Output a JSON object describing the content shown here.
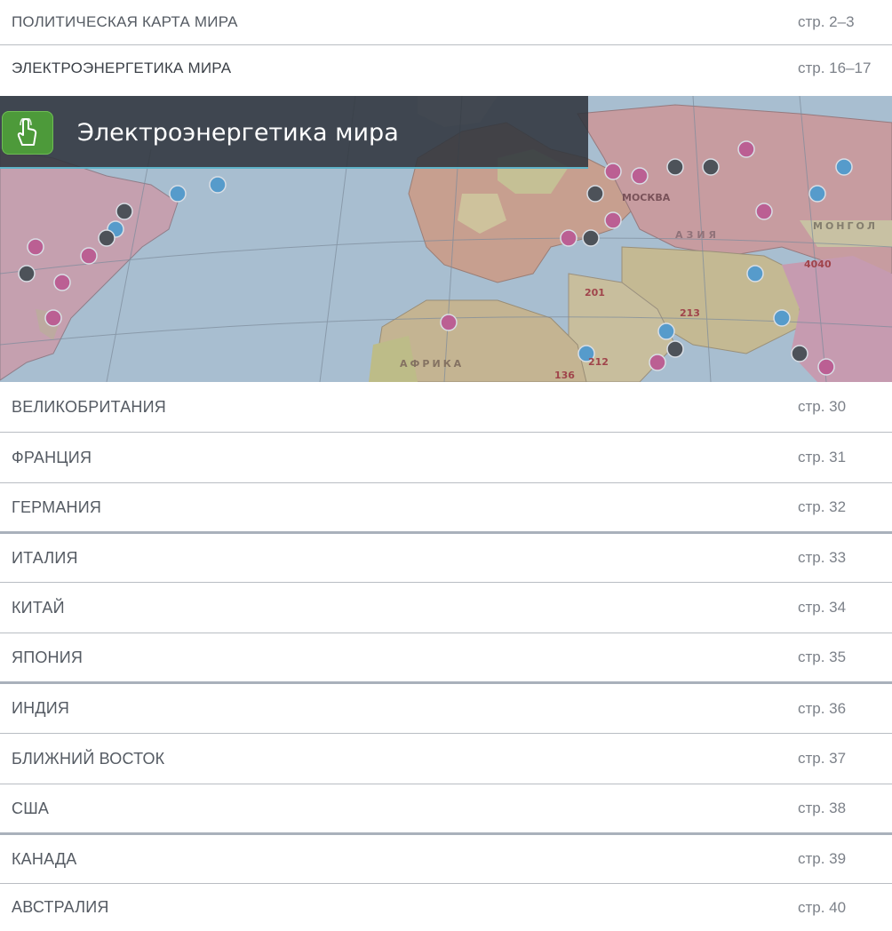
{
  "top_items": [
    {
      "label": "ПОЛИТИЧЕСКАЯ КАРТА МИРА",
      "page": "стр. 2–3"
    },
    {
      "label": "ЭЛЕКТРОЭНЕРГЕТИКА МИРА",
      "page": "стр. 16–17"
    }
  ],
  "banner": {
    "title": "Электроэнергетика мира",
    "map_labels": {
      "moscow": "МОСКВА",
      "asia": "АЗИЯ",
      "mongolia": "МОНГОЛ",
      "africa": "АФРИКА",
      "n201": "201",
      "n213": "213",
      "n4040": "4040",
      "n212": "212",
      "n136": "136"
    },
    "accent": "#5fb3c8",
    "button_color": "#4d9a3a"
  },
  "countries": [
    {
      "label": "ВЕЛИКОБРИТАНИЯ",
      "page": "стр. 30"
    },
    {
      "label": "ФРАНЦИЯ",
      "page": "стр. 31"
    },
    {
      "label": "ГЕРМАНИЯ",
      "page": "стр. 32"
    },
    {
      "label": "ИТАЛИЯ",
      "page": "стр. 33"
    },
    {
      "label": "КИТАЙ",
      "page": "стр. 34"
    },
    {
      "label": "ЯПОНИЯ",
      "page": "стр. 35"
    },
    {
      "label": "ИНДИЯ",
      "page": "стр. 36"
    },
    {
      "label": "БЛИЖНИЙ ВОСТОК",
      "page": "стр. 37"
    },
    {
      "label": "США",
      "page": "стр. 38"
    },
    {
      "label": "КАНАДА",
      "page": "стр. 39"
    },
    {
      "label": "АВСТРАЛИЯ",
      "page": "стр. 40"
    }
  ]
}
